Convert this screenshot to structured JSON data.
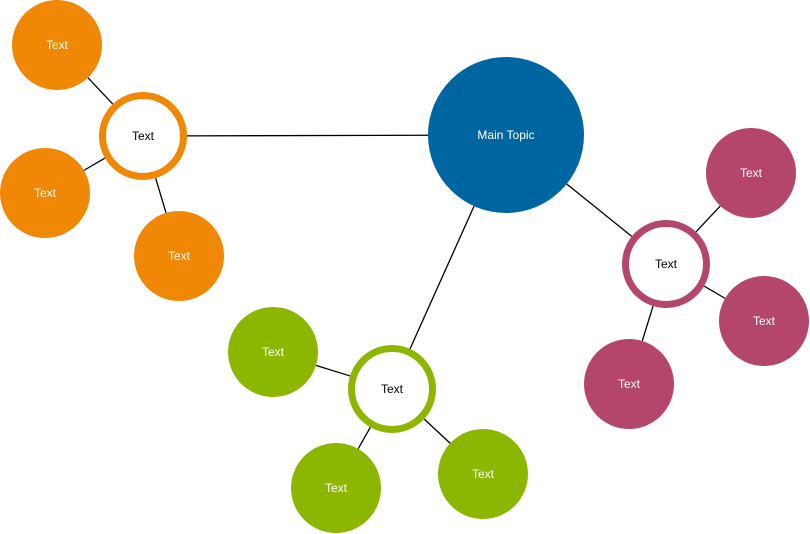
{
  "diagram": {
    "type": "mind-map",
    "main_topic": {
      "label": "Main Topic",
      "color": "#0066a1",
      "text_color": "#ffffff"
    },
    "branches": [
      {
        "id": "orange",
        "color": "#f08705",
        "hub_label": "Text",
        "children": [
          {
            "label": "Text"
          },
          {
            "label": "Text"
          },
          {
            "label": "Text"
          }
        ]
      },
      {
        "id": "magenta",
        "color": "#b5466b",
        "hub_label": "Text",
        "children": [
          {
            "label": "Text"
          },
          {
            "label": "Text"
          },
          {
            "label": "Text"
          }
        ]
      },
      {
        "id": "green",
        "color": "#8db600",
        "hub_label": "Text",
        "children": [
          {
            "label": "Text"
          },
          {
            "label": "Text"
          },
          {
            "label": "Text"
          }
        ]
      }
    ],
    "connector_color": "#000000",
    "hub_fill": "#ffffff",
    "hub_text_color": "#000000",
    "leaf_text_color": "#ffffff"
  }
}
